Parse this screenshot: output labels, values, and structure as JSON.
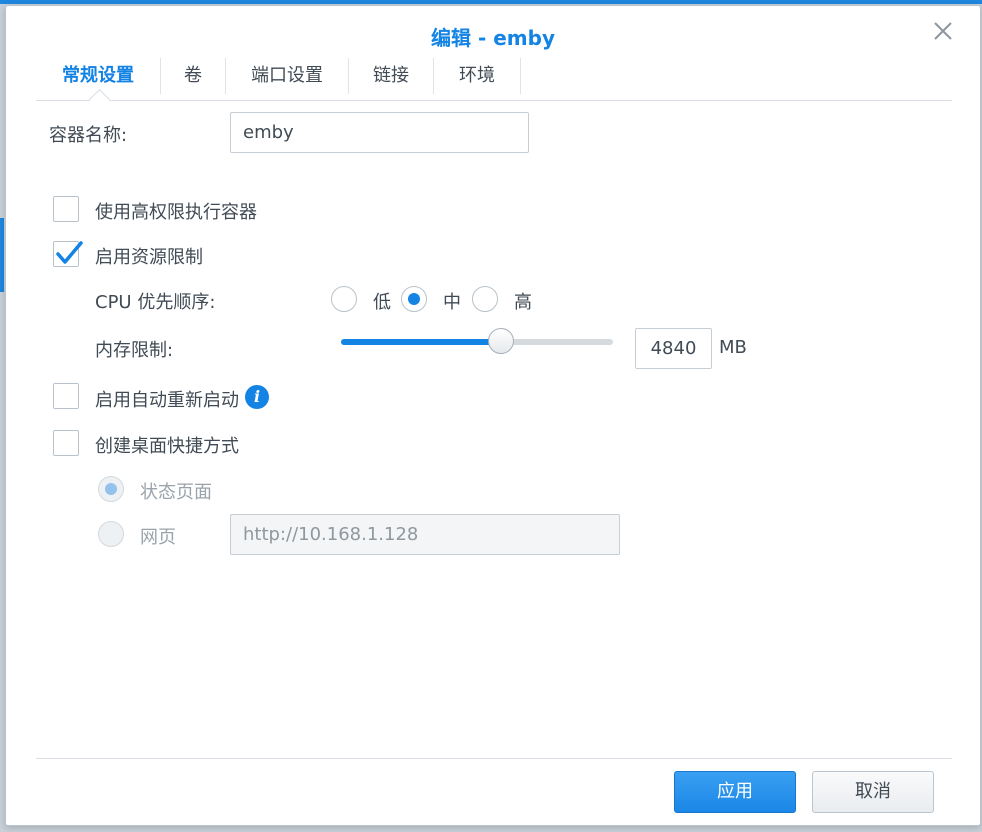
{
  "dialog": {
    "title": "编辑 - emby"
  },
  "tabs": [
    {
      "label": "常规设置"
    },
    {
      "label": "卷"
    },
    {
      "label": "端口设置"
    },
    {
      "label": "链接"
    },
    {
      "label": "环境"
    }
  ],
  "form": {
    "container_name_label": "容器名称:",
    "container_name_value": "emby",
    "privileged_label": "使用高权限执行容器",
    "resource_limit_label": "启用资源限制",
    "cpu_priority_label": "CPU 优先顺序:",
    "cpu_options": [
      "低",
      "中",
      "高"
    ],
    "cpu_selected": "中",
    "memory_limit_label": "内存限制:",
    "memory_value": "4840",
    "memory_unit": "MB",
    "memory_slider_fraction": 0.59,
    "auto_restart_label": "启用自动重新启动",
    "shortcut_label": "创建桌面快捷方式",
    "status_page_label": "状态页面",
    "webpage_label": "网页",
    "webpage_url": "http://10.168.1.128"
  },
  "buttons": {
    "apply": "应用",
    "cancel": "取消"
  },
  "colors": {
    "accent": "#1383e4"
  }
}
